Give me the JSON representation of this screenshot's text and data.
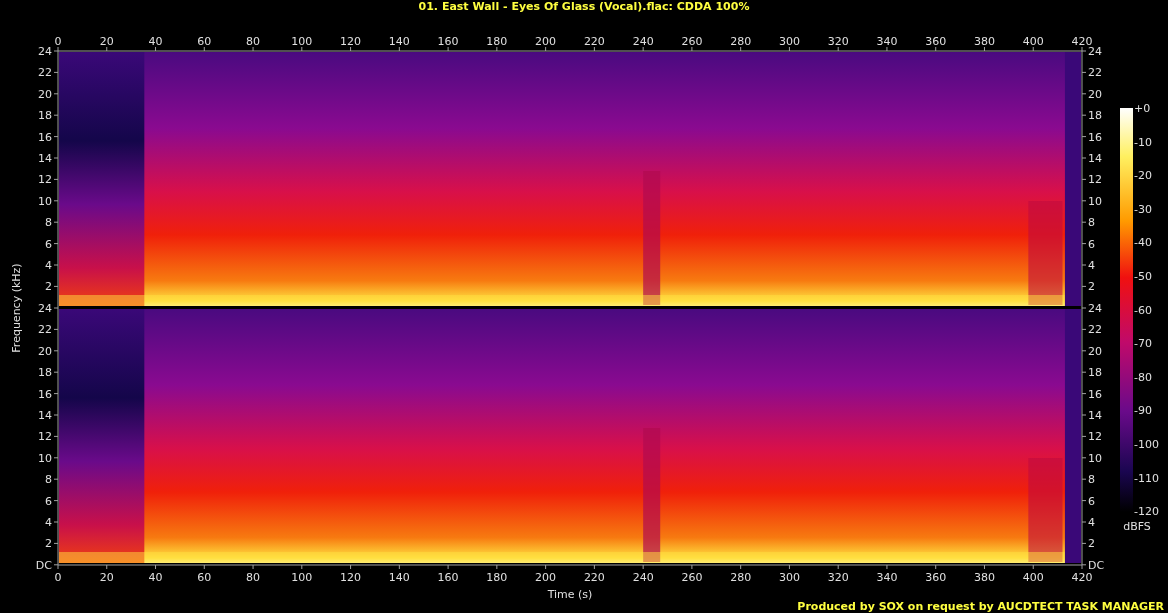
{
  "title": "01. East Wall - Eyes Of Glass (Vocal).flac: CDDA 100%",
  "time_axis": {
    "label": "Time (s)",
    "top_ticks": [
      "0",
      "20",
      "40",
      "60",
      "80",
      "100",
      "120",
      "140",
      "160",
      "180",
      "200",
      "220",
      "240",
      "260",
      "280",
      "300",
      "320",
      "340",
      "360",
      "380",
      "400",
      "420"
    ],
    "bottom_ticks": [
      "0",
      "20",
      "40",
      "60",
      "80",
      "100",
      "120",
      "140",
      "160",
      "180",
      "200",
      "220",
      "240",
      "260",
      "280",
      "300",
      "320",
      "340",
      "360",
      "380",
      "400",
      "420"
    ]
  },
  "frequency_axis": {
    "label": "Frequency (kHz)"
  },
  "channels": [
    {
      "left_ticks": [
        "24",
        "22",
        "20",
        "18",
        "16",
        "14",
        "12",
        "10",
        "8",
        "6",
        "4",
        "2"
      ],
      "right_ticks": [
        "24",
        "22",
        "20",
        "18",
        "16",
        "14",
        "12",
        "10",
        "8",
        "6",
        "4",
        "2"
      ]
    },
    {
      "left_ticks": [
        "24",
        "22",
        "20",
        "18",
        "16",
        "14",
        "12",
        "10",
        "8",
        "6",
        "4",
        "2",
        "DC"
      ],
      "right_ticks": [
        "24",
        "22",
        "20",
        "18",
        "16",
        "14",
        "12",
        "10",
        "8",
        "6",
        "4",
        "2",
        "DC"
      ]
    }
  ],
  "colorbar": {
    "ticks": [
      "+0",
      "-10",
      "-20",
      "-30",
      "-40",
      "-50",
      "-60",
      "-70",
      "-80",
      "-90",
      "-100",
      "-110",
      "-120"
    ],
    "unit": "dBFS"
  },
  "footer": "Produced by SOX on request by AUCDTECT TASK MANAGER"
}
